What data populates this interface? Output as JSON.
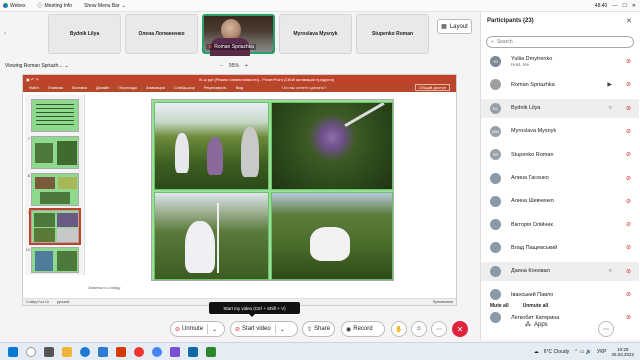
{
  "topbar": {
    "app_name": "Webex",
    "menu": [
      "Meeting Info",
      "Show Menu Bar"
    ],
    "time": "48:40"
  },
  "tiles": [
    {
      "name": "Bydnik Lilya"
    },
    {
      "name": "Олена Логвиненко"
    },
    {
      "name": "Roman Spriazhka",
      "active": true
    },
    {
      "name": "Myroslava Mysnyk"
    },
    {
      "name": "Stupenko Roman"
    }
  ],
  "layout_label": "Layout",
  "viewing": "Viewing Roman Spriazh...",
  "zoom": "95%",
  "ppt": {
    "title": "Xl-ш ppt [Режим совместимости] - PowerPoint (Сбой активации продукта)",
    "tabs": [
      "Файл",
      "Главная",
      "Вставка",
      "Дизайн",
      "Переходы",
      "Анимация",
      "Слайд-шоу",
      "Рецензиров.",
      "Вид",
      "Что вы хотите сделать?",
      "Общий доступ"
    ],
    "thumb_nums": [
      "",
      "7",
      "8",
      "9",
      "10"
    ],
    "notes": "Заметки к слайду",
    "status": [
      "Слайд 9 из 10",
      "русский",
      "Примечания"
    ]
  },
  "tooltip": "Start my video (Ctrl + Shift + V)",
  "controls": {
    "unmute": "Unmute",
    "start_video": "Start video",
    "share": "Share",
    "record": "Record"
  },
  "participants": {
    "title": "Participants (23)",
    "search_placeholder": "Search",
    "rows": [
      {
        "initials": "YD",
        "name": "Yuliia Dmytrenko",
        "sub": "Host, me",
        "muted": true,
        "color": "#7b8794"
      },
      {
        "initials": "",
        "name": "Roman Spriazhka",
        "sub": "",
        "muted": true,
        "color": "#a0a0a0",
        "video": true
      },
      {
        "initials": "BL",
        "name": "Bydnik Lilya",
        "sub": "",
        "muted": true,
        "color": "#9aa0a6",
        "hl": true,
        "chat": true
      },
      {
        "initials": "MM",
        "name": "Myroslava Mysnyk",
        "sub": "",
        "muted": true,
        "color": "#9aa0a6"
      },
      {
        "initials": "SR",
        "name": "Stupenko Roman",
        "sub": "",
        "muted": true,
        "color": "#9aa0a6"
      },
      {
        "initials": "",
        "name": "Алина Гасенко",
        "sub": "",
        "muted": true,
        "color": "#8a9aa8"
      },
      {
        "initials": "",
        "name": "Алина Шевченко",
        "sub": "",
        "muted": true,
        "color": "#8a9aa8"
      },
      {
        "initials": "",
        "name": "Вікторія Олійник",
        "sub": "",
        "muted": true,
        "color": "#8a9aa8"
      },
      {
        "initials": "",
        "name": "Влад Пащевський",
        "sub": "",
        "muted": true,
        "color": "#8a9aa8"
      },
      {
        "initials": "",
        "name": "Даяна Коновал",
        "sub": "",
        "muted": true,
        "color": "#8a9aa8",
        "hl": true,
        "chat": true
      },
      {
        "initials": "",
        "name": "Іванський Павло",
        "sub": "",
        "muted": true,
        "color": "#8a9aa8"
      },
      {
        "initials": "",
        "name": "Легкобит Катерина",
        "sub": "",
        "muted": true,
        "color": "#8a9aa8"
      }
    ],
    "mute_all": "Mute all",
    "unmute_all": "Unmute all"
  },
  "apps_label": "Apps",
  "taskbar": {
    "weather": "6°C  Cloudy",
    "lang": "УКР",
    "time": "10:29",
    "date": "25.03.2022"
  }
}
